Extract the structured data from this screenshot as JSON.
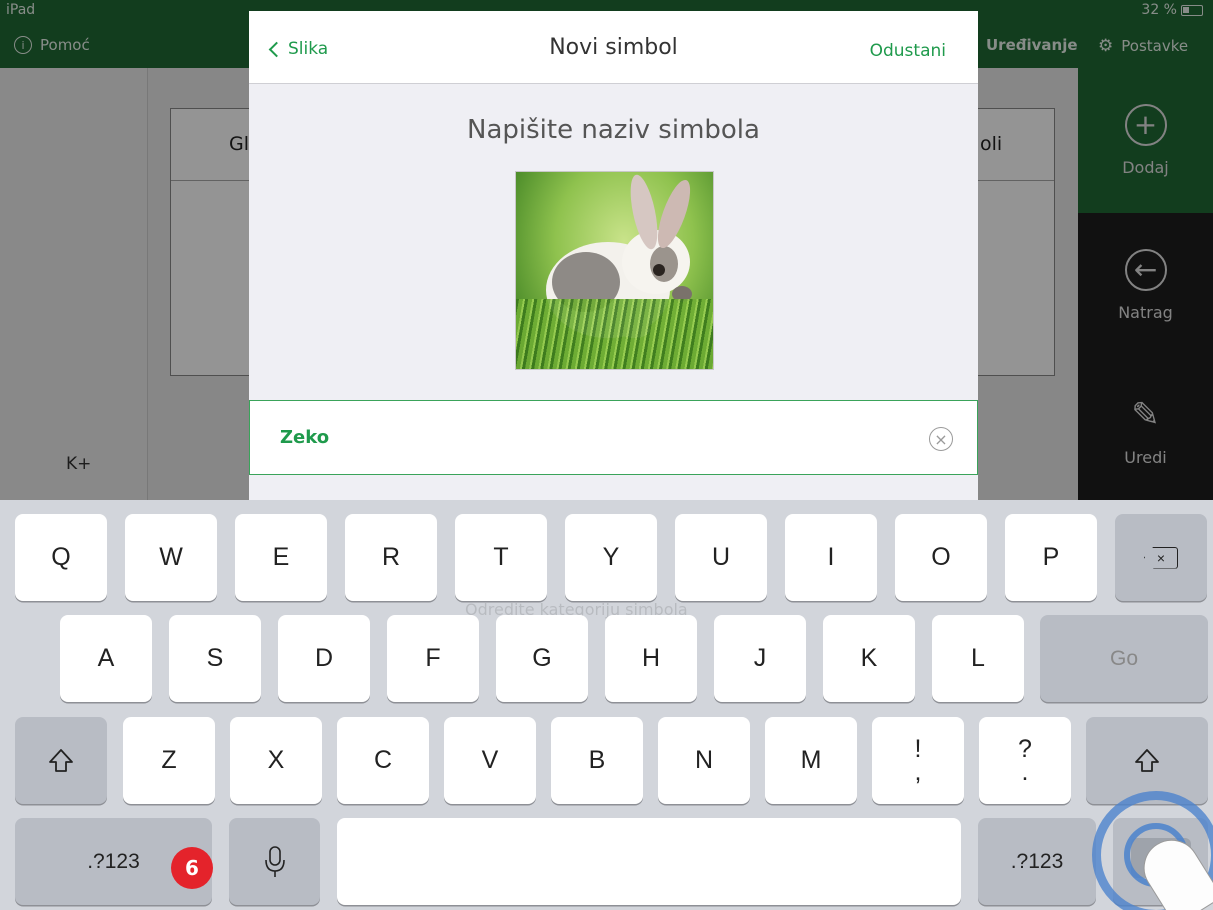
{
  "status_bar": {
    "device": "iPad",
    "battery": "32 %",
    "help_label": "Pomoć",
    "edit_label": "Uređivanje",
    "settings_label": "Postavke"
  },
  "board": {
    "left_card_title": "Gl",
    "right_card_title": "oli",
    "bottom_label": "K+"
  },
  "sidebar": {
    "add_label": "Dodaj",
    "back_label": "Natrag",
    "edit_label": "Uredi"
  },
  "modal": {
    "back_label": "Slika",
    "title": "Novi simbol",
    "cancel_label": "Odustani",
    "prompt": "Napišite naziv simbola",
    "name_value": "Zeko",
    "ghost_text": "Odredite kategoriju simbola"
  },
  "keyboard": {
    "row1": [
      "Q",
      "W",
      "E",
      "R",
      "T",
      "Y",
      "U",
      "I",
      "O",
      "P"
    ],
    "row2": [
      "A",
      "S",
      "D",
      "F",
      "G",
      "H",
      "J",
      "K",
      "L"
    ],
    "row3": [
      "Z",
      "X",
      "C",
      "V",
      "B",
      "N",
      "M"
    ],
    "punct1": [
      "!",
      ","
    ],
    "punct2": [
      "?",
      "."
    ],
    "go_label": "Go",
    "numbers_label": ".?123"
  },
  "step_badge": "6",
  "colors": {
    "brand_green": "#1f6a34",
    "accent_green": "#1f9a4c",
    "badge_red": "#e4232b",
    "touch_ring_blue": "#4a82cd"
  }
}
